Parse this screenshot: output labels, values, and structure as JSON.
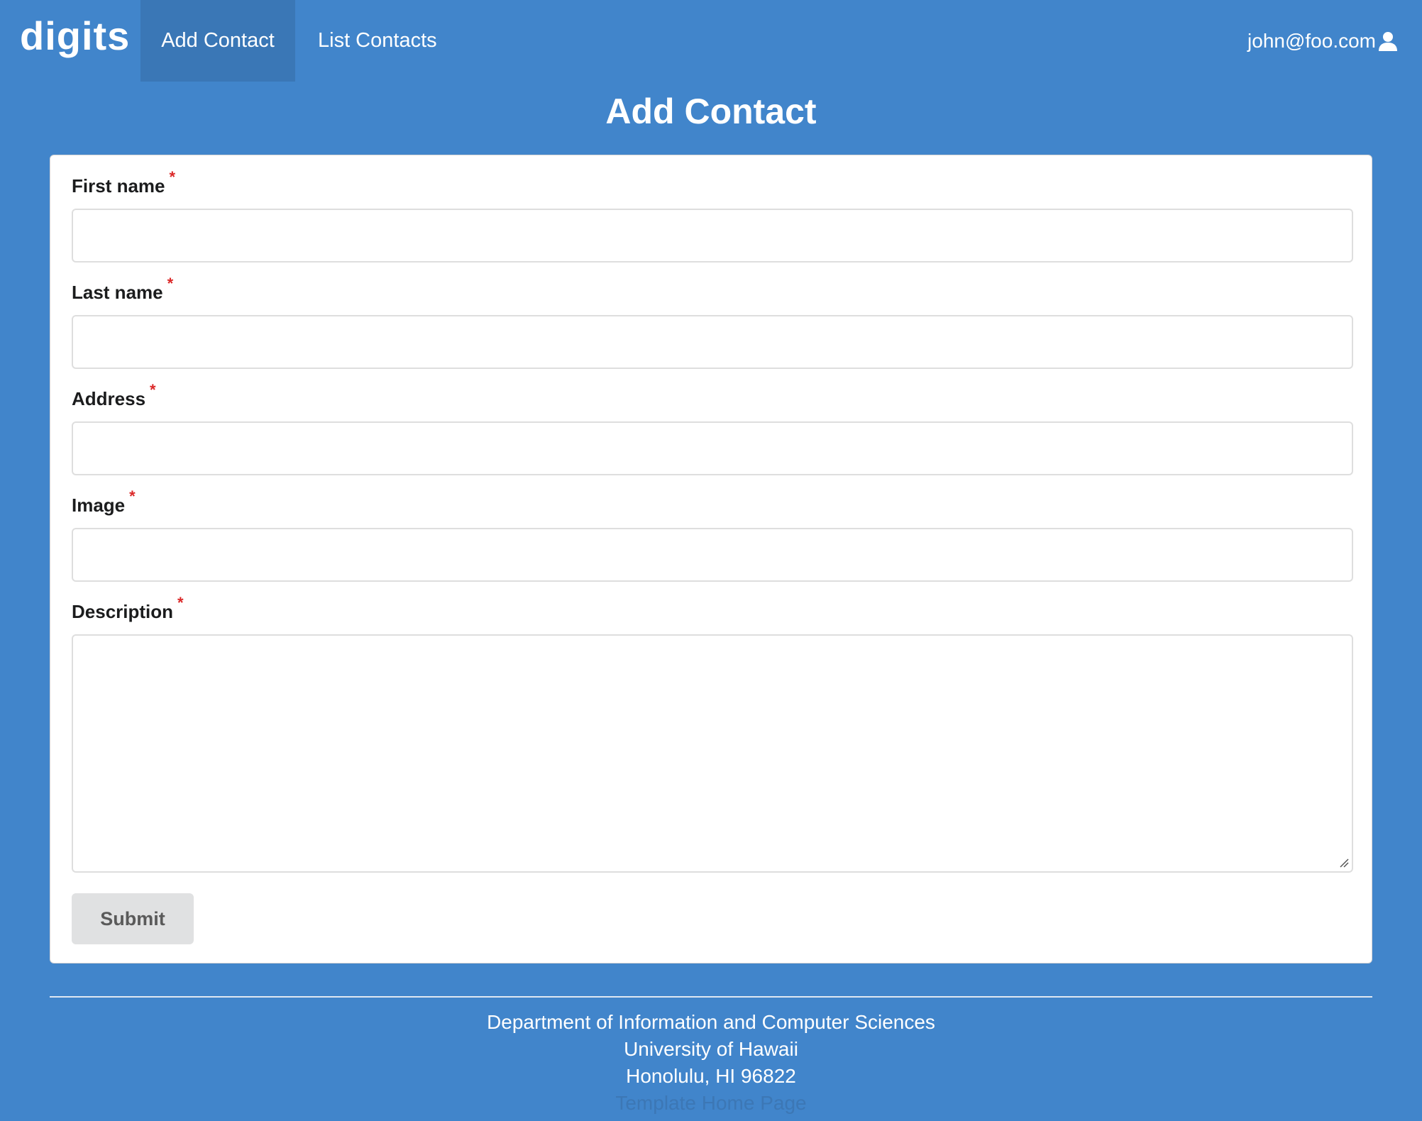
{
  "navbar": {
    "brand": "digits",
    "items": [
      {
        "label": "Add Contact",
        "active": true
      },
      {
        "label": "List Contacts",
        "active": false
      }
    ],
    "user_email": "john@foo.com",
    "user_icon": "user-icon"
  },
  "page": {
    "title": "Add Contact"
  },
  "form": {
    "required_marker": "*",
    "fields": [
      {
        "label": "First name",
        "value": "",
        "required": true
      },
      {
        "label": "Last name",
        "value": "",
        "required": true
      },
      {
        "label": "Address",
        "value": "",
        "required": true
      },
      {
        "label": "Image",
        "value": "",
        "required": true
      },
      {
        "label": "Description",
        "value": "",
        "required": true
      }
    ],
    "submit_label": "Submit"
  },
  "footer": {
    "lines": [
      "Department of Information and Computer Sciences",
      "University of Hawaii",
      "Honolulu, HI 96822"
    ],
    "link_text": "Template Home Page"
  },
  "colors": {
    "background": "#4185cb",
    "active_nav": "#3a77b6",
    "required": "#db2828",
    "submit_bg": "#e0e1e2"
  }
}
